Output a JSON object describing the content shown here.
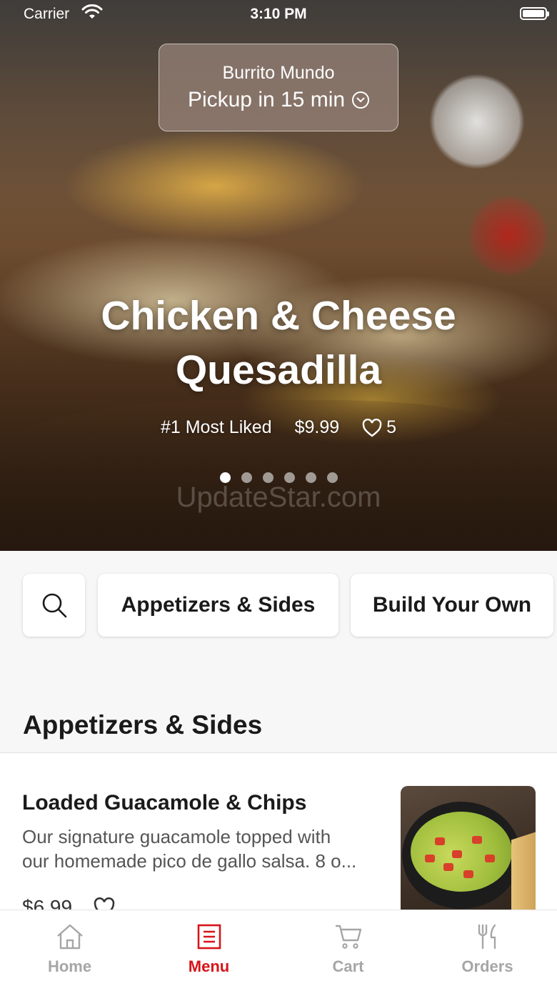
{
  "status_bar": {
    "carrier": "Carrier",
    "time": "3:10 PM"
  },
  "pickup": {
    "store_name": "Burrito Mundo",
    "pickup_time": "Pickup in 15 min"
  },
  "hero": {
    "title_line1": "Chicken & Cheese",
    "title_line2": "Quesadilla",
    "badge": "#1 Most Liked",
    "price": "$9.99",
    "like_count": "5",
    "carousel_pages": 6,
    "carousel_active_index": 0,
    "watermark": "UpdateStar.com"
  },
  "category_chips": [
    {
      "label": "Appetizers & Sides"
    },
    {
      "label": "Build Your Own"
    }
  ],
  "section": {
    "title": "Appetizers & Sides"
  },
  "items": [
    {
      "name": "Loaded Guacamole & Chips",
      "description_line1": "Our signature guacamole topped with",
      "description_line2": "our homemade pico de gallo salsa. 8 o...",
      "price": "$6.99"
    }
  ],
  "tab_bar": {
    "tabs": [
      {
        "label": "Home",
        "icon": "home-icon"
      },
      {
        "label": "Menu",
        "icon": "menu-icon"
      },
      {
        "label": "Cart",
        "icon": "cart-icon"
      },
      {
        "label": "Orders",
        "icon": "orders-icon"
      }
    ],
    "active_index": 1
  },
  "colors": {
    "accent": "#d7141a",
    "inactive_tab": "#a6a6a6",
    "background": "#f7f7f7"
  }
}
